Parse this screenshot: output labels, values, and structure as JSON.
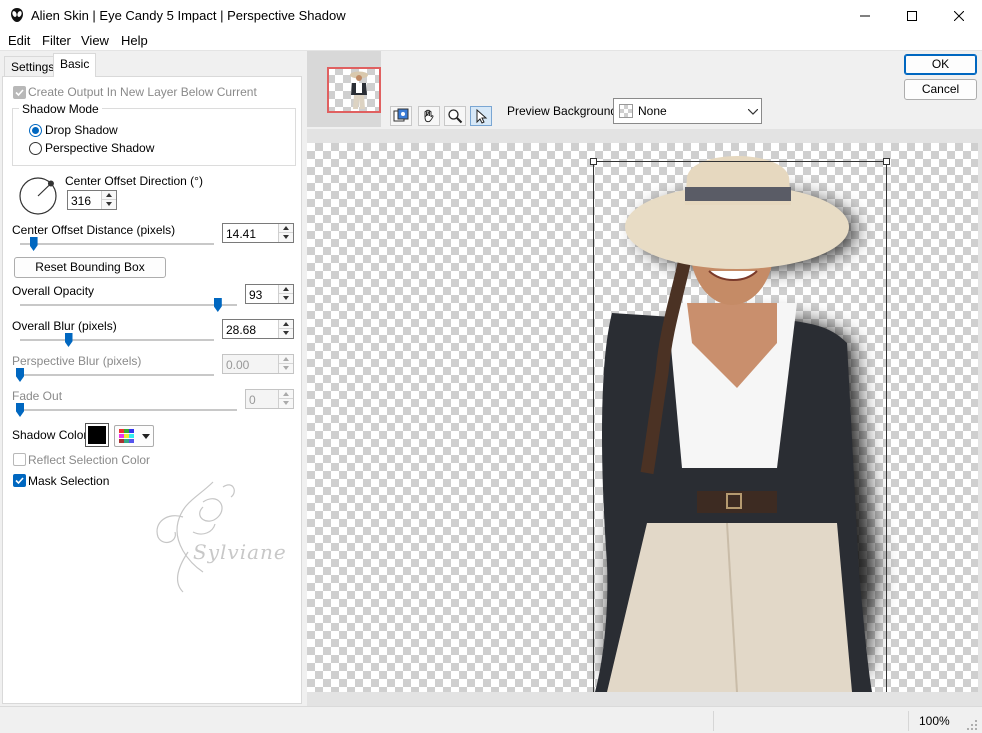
{
  "window": {
    "title": "Alien Skin | Eye Candy 5 Impact | Perspective Shadow",
    "minimize_icon": "minimize-icon",
    "maximize_icon": "maximize-icon",
    "close_icon": "close-icon"
  },
  "menu": [
    "Edit",
    "Filter",
    "View",
    "Help"
  ],
  "tabs": {
    "settings": "Settings",
    "basic": "Basic"
  },
  "basic": {
    "create_output_label": "Create Output In New Layer Below Current",
    "create_output_checked": true,
    "shadow_mode_label": "Shadow Mode",
    "drop_shadow_label": "Drop Shadow",
    "perspective_shadow_label": "Perspective Shadow",
    "selected_mode": "Drop Shadow",
    "center_offset_direction_label": "Center Offset Direction (°)",
    "center_offset_direction_value": "316",
    "center_offset_distance_label": "Center Offset Distance (pixels)",
    "center_offset_distance_value": "14.41",
    "center_offset_distance_level": 0.07,
    "reset_button_label": "Reset Bounding Box",
    "overall_opacity_label": "Overall Opacity",
    "overall_opacity_value": "93",
    "overall_opacity_level": 0.93,
    "overall_blur_label": "Overall Blur (pixels)",
    "overall_blur_value": "28.68",
    "overall_blur_level": 0.25,
    "perspective_blur_label": "Perspective Blur (pixels)",
    "perspective_blur_value": "0.00",
    "perspective_blur_level": 0.0,
    "fade_out_label": "Fade Out",
    "fade_out_value": "0",
    "fade_out_level": 0.0,
    "shadow_color_label": "Shadow Color",
    "shadow_color": "#000000",
    "reflect_selection_label": "Reflect Selection Color",
    "reflect_selection_checked": false,
    "mask_selection_label": "Mask Selection",
    "mask_selection_checked": true,
    "watermark_text": "Sylviane"
  },
  "toolbar": {
    "tools": [
      "preview-compare-icon",
      "hand-icon",
      "zoom-icon",
      "pointer-icon"
    ],
    "preview_background_label": "Preview Background:",
    "preview_background_value": "None"
  },
  "buttons": {
    "ok": "OK",
    "cancel": "Cancel"
  },
  "status": {
    "zoom": "100%"
  },
  "colors": {
    "accent": "#0067c0",
    "thumbnail_border": "#e06060"
  }
}
